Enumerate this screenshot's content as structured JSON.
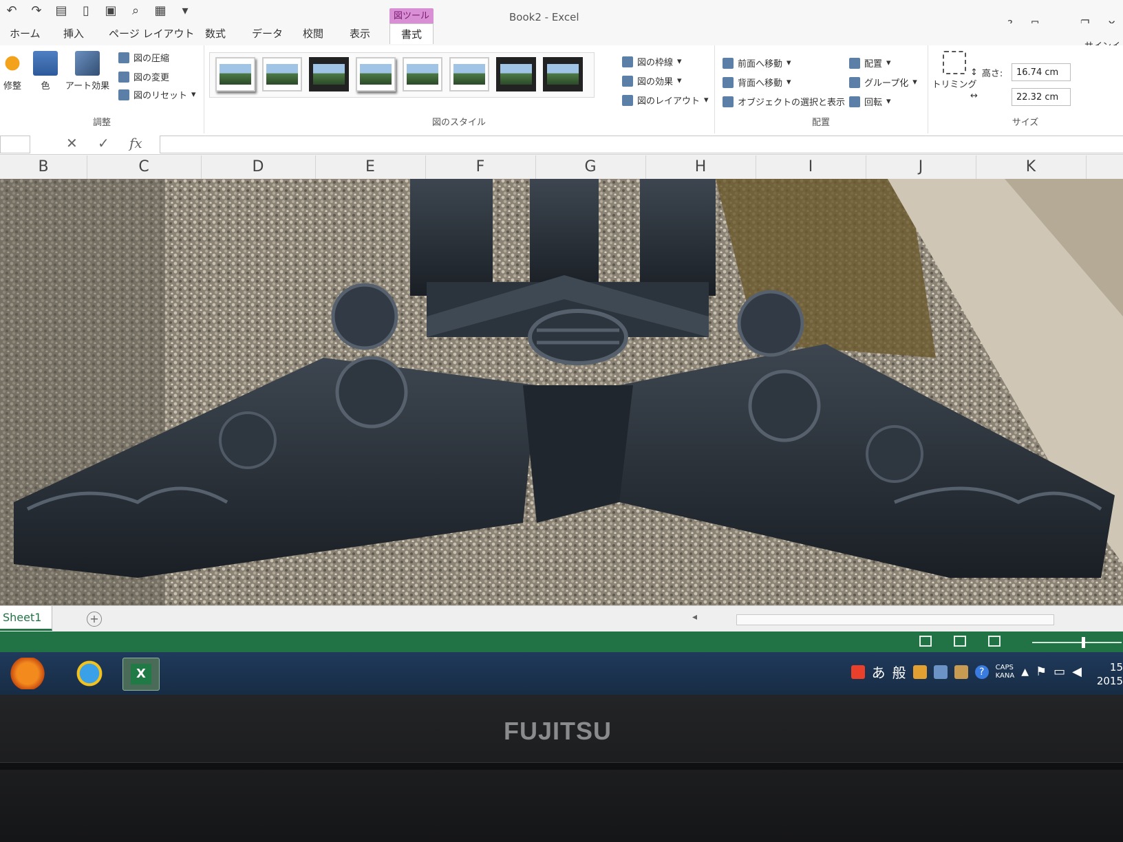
{
  "window": {
    "title": "Book2 - Excel",
    "context_tab": "図ツール"
  },
  "tabs": [
    "ホーム",
    "挿入",
    "ページ レイアウト",
    "数式",
    "データ",
    "校閲",
    "表示",
    "書式"
  ],
  "signin": "サインイ",
  "ribbon": {
    "adjust": {
      "label": "調整",
      "buttons": [
        "修整",
        "色",
        "アート効果"
      ],
      "small": [
        "図の圧縮",
        "図の変更",
        "図のリセット"
      ]
    },
    "styles": {
      "label": "図のスタイル",
      "options": [
        "図の枠線",
        "図の効果",
        "図のレイアウト"
      ]
    },
    "arrange": {
      "label": "配置",
      "items": [
        "前面へ移動",
        "背面へ移動",
        "オブジェクトの選択と表示",
        "配置",
        "グループ化",
        "回転"
      ]
    },
    "size": {
      "label": "サイズ",
      "trim": "トリミング",
      "height_label": "高さ:",
      "height": "16.74 cm",
      "width": "22.32 cm"
    }
  },
  "formula_bar": {
    "cancel": "✕",
    "enter": "✓",
    "fx": "fx"
  },
  "columns": [
    "B",
    "C",
    "D",
    "E",
    "F",
    "G",
    "H",
    "I",
    "J",
    "K"
  ],
  "sheet": {
    "tab": "Sheet1",
    "add": "+"
  },
  "taskbar": {
    "tray": [
      "あ",
      "般"
    ],
    "caps": "CAPS",
    "kana": "KANA",
    "clock_time": "15",
    "clock_year": "2015"
  },
  "bezel": {
    "brand": "FUJITSU"
  }
}
